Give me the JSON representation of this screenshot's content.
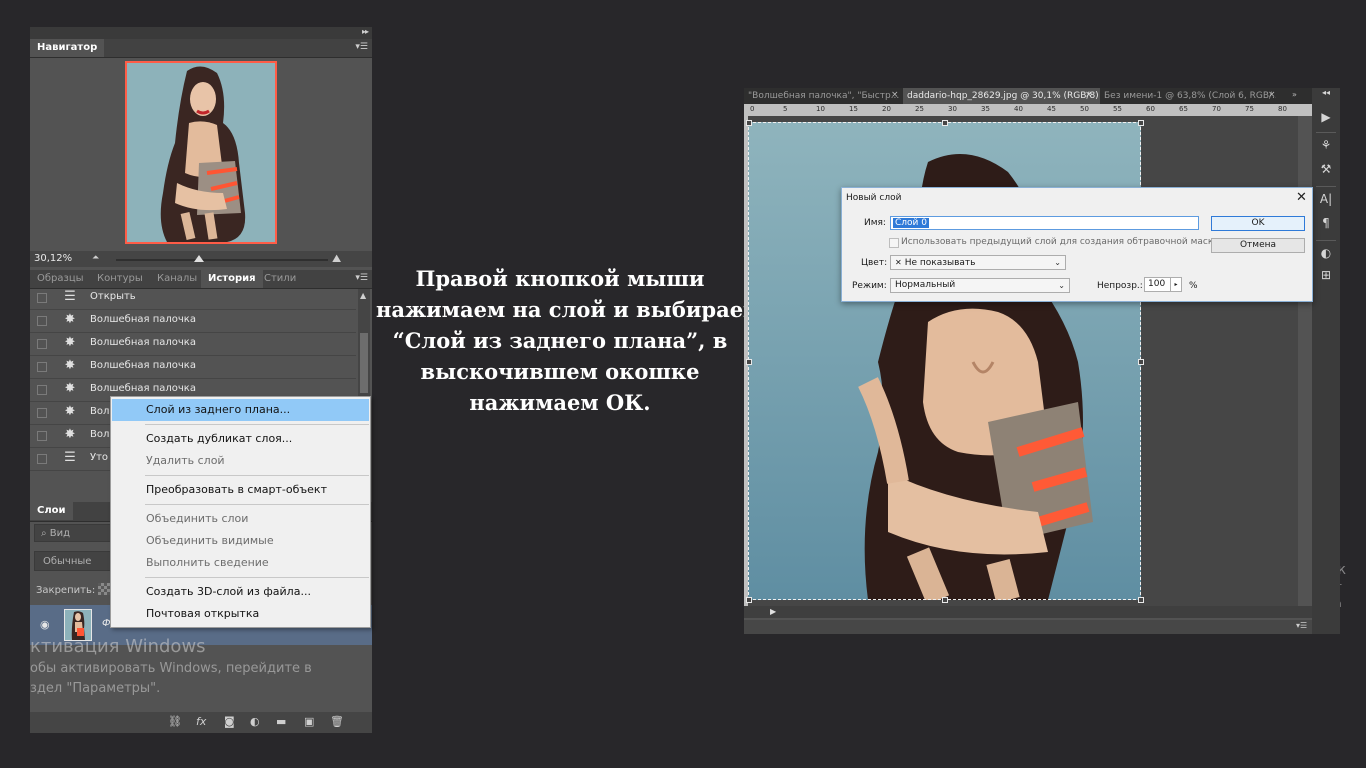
{
  "left_panel": {
    "navigator": {
      "tab": "Навигатор",
      "zoom": "30,12%"
    },
    "tabs": [
      "Образцы",
      "Контуры",
      "Каналы",
      "История",
      "Стили"
    ],
    "history_items": [
      {
        "label": "Открыть",
        "icon": "document-icon"
      },
      {
        "label": "Волшебная палочка",
        "icon": "magic-wand-icon"
      },
      {
        "label": "Волшебная палочка",
        "icon": "magic-wand-icon"
      },
      {
        "label": "Волшебная палочка",
        "icon": "magic-wand-icon"
      },
      {
        "label": "Волшебная палочка",
        "icon": "magic-wand-icon"
      },
      {
        "label": "Вол",
        "icon": "magic-wand-icon"
      },
      {
        "label": "Вол",
        "icon": "magic-wand-icon"
      },
      {
        "label": "Уто",
        "icon": "document-icon"
      }
    ],
    "layers": {
      "tab": "Слои",
      "filter_placeholder": "Вид",
      "blend_mode": "Обычные",
      "lock_label": "Закрепить:",
      "layer_name_fragment": "Ф"
    }
  },
  "context_menu": {
    "items": [
      {
        "label": "Слой из заднего плана...",
        "state": "highlighted"
      },
      {
        "label": "Создать дубликат слоя...",
        "state": "enabled"
      },
      {
        "label": "Удалить слой",
        "state": "disabled"
      },
      {
        "label": "Преобразовать в смарт-объект",
        "state": "enabled"
      },
      {
        "label": "Объединить слои",
        "state": "disabled"
      },
      {
        "label": "Объединить видимые",
        "state": "disabled"
      },
      {
        "label": "Выполнить сведение",
        "state": "disabled"
      },
      {
        "label": "Создать 3D-слой из файла...",
        "state": "enabled"
      },
      {
        "label": "Почтовая открытка",
        "state": "enabled"
      }
    ]
  },
  "watermark": {
    "line1": "ктивация Windows",
    "line2": "обы активировать Windows, перейдите в",
    "line3": "здел \"Параметры\".",
    "right_fragment1": "Ак",
    "right_fragment2": "Чт",
    "right_fragment3": "ра"
  },
  "instruction": {
    "line1": "Правой кнопкой мыши",
    "line2": "нажимаем на слой и выбираем",
    "line3": "“Слой из заднего плана”, в",
    "line4": "выскочившем окошке",
    "line5": "нажимаем ОК."
  },
  "document": {
    "tabs": [
      {
        "label": "\"Волшебная палочка\", \"Быстр...",
        "active": false
      },
      {
        "label": "daddario-hqp_28629.jpg @ 30,1% (RGB/8)",
        "active": true
      },
      {
        "label": "Без имени-1 @ 63,8% (Слой 6, RGB/...",
        "active": false
      }
    ],
    "ruler_labels": [
      "0",
      "5",
      "10",
      "15",
      "20",
      "25",
      "30",
      "35",
      "40",
      "45",
      "50",
      "55",
      "60",
      "65",
      "70",
      "75",
      "80"
    ]
  },
  "new_layer_dialog": {
    "title": "Новый слой",
    "name_label": "Имя:",
    "name_value": "Слой 0",
    "clipping_label": "Использовать предыдущий слой для создания обтравочной маски",
    "color_label": "Цвет:",
    "color_value": "Не показывать",
    "mode_label": "Режим:",
    "mode_value": "Нормальный",
    "opacity_label": "Непрозр.:",
    "opacity_value": "100",
    "opacity_unit": "%",
    "ok": "OK",
    "cancel": "Отмена"
  },
  "colors": {
    "background": "#28272a",
    "panel": "#535353",
    "navigator_frame": "#ff5c47",
    "menu_highlight": "#91c9f7",
    "selected_layer": "#596c87",
    "name_selection": "#2f7ad8"
  }
}
